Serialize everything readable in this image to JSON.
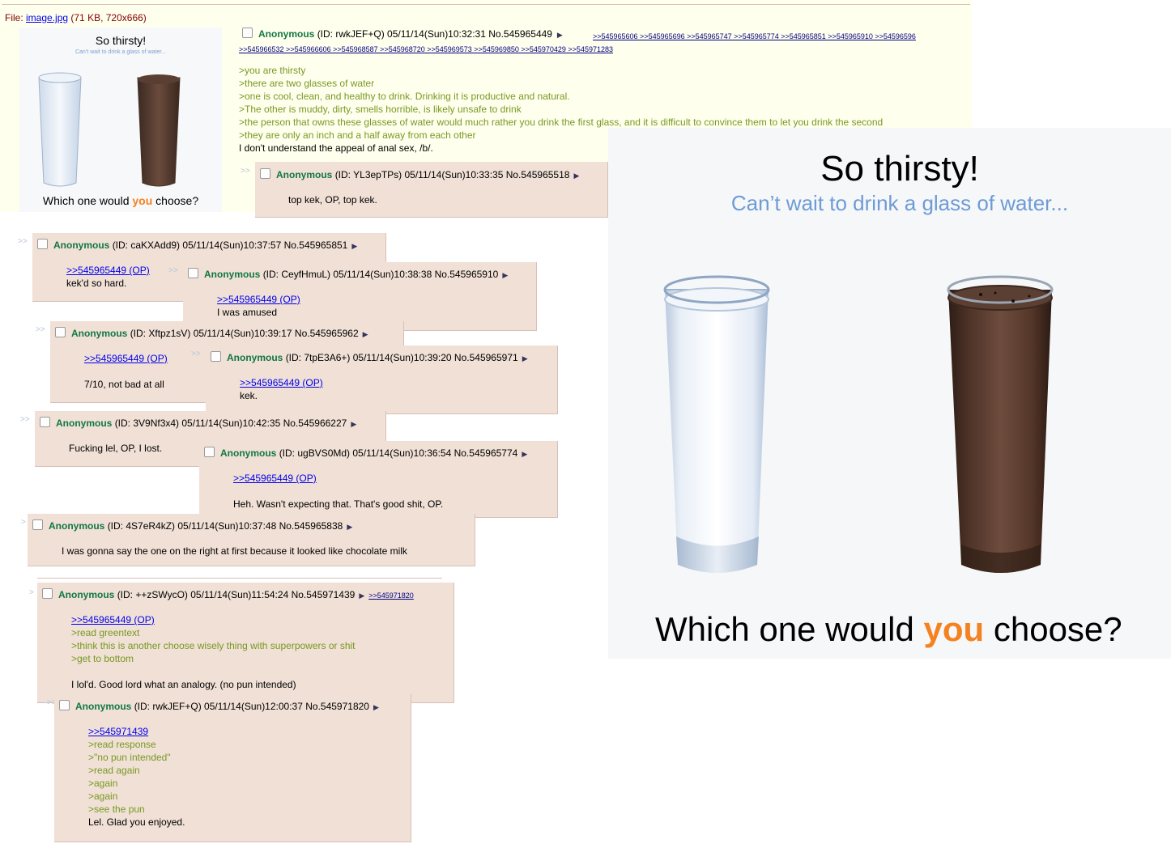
{
  "op": {
    "file_label": "File:",
    "file_name": "image.jpg",
    "file_meta": "(71 KB, 720x666)",
    "name": "Anonymous",
    "meta": "(ID: rwkJEF+Q) 05/11/14(Sun)10:32:31 No.545965449",
    "backlinks_row1": ">>545965606 >>545965696 >>545965747 >>545965774 >>545965851 >>545965910 >>54596596",
    "backlinks_row2": ">>545966532 >>545966606 >>545968587 >>545968720 >>545969573 >>545969850 >>545970429 >>545971283",
    "lines": [
      ">you are thirsty",
      ">there are two glasses of water",
      ">one is cool, clean, and healthy to drink. Drinking it is productive and natural.",
      ">The other is muddy, dirty, smells horrible, is likely unsafe to drink",
      ">the person that owns these glasses of water would much rather you drink the first glass, and it is difficult to convince them to let you drink the second",
      ">they are only an inch and a half away from each other",
      "I don't understand the appeal of anal sex, /b/."
    ]
  },
  "image": {
    "title": "So thirsty!",
    "subtitle": "Can’t wait to drink a glass of water...",
    "bottom_pre": "Which one would ",
    "bottom_you": "you",
    "bottom_post": " choose?"
  },
  "posts": [
    {
      "name": "Anonymous",
      "meta": "(ID: YL3epTPs) 05/11/14(Sun)10:33:35 No.545965518",
      "lines": [
        "top kek, OP, top kek."
      ]
    },
    {
      "name": "Anonymous",
      "meta": "(ID: caKXAdd9) 05/11/14(Sun)10:37:57 No.545965851",
      "link": ">>545965449 (OP)",
      "lines": [
        "kek'd so hard."
      ]
    },
    {
      "name": "Anonymous",
      "meta": "(ID: CeyfHmuL) 05/11/14(Sun)10:38:38 No.545965910",
      "link": ">>545965449 (OP)",
      "lines": [
        "I was amused"
      ]
    },
    {
      "name": "Anonymous",
      "meta": "(ID: Xftpz1sV) 05/11/14(Sun)10:39:17 No.545965962",
      "link": ">>545965449 (OP)",
      "lines": [
        "7/10, not bad at all"
      ]
    },
    {
      "name": "Anonymous",
      "meta": "(ID: 7tpE3A6+) 05/11/14(Sun)10:39:20 No.545965971",
      "link": ">>545965449 (OP)",
      "lines": [
        "kek."
      ]
    },
    {
      "name": "Anonymous",
      "meta": "(ID: 3V9Nf3x4) 05/11/14(Sun)10:42:35 No.545966227",
      "lines": [
        "Fucking lel, OP, I lost."
      ]
    },
    {
      "name": "Anonymous",
      "meta": "(ID: ugBVS0Md) 05/11/14(Sun)10:36:54 No.545965774",
      "link": ">>545965449 (OP)",
      "lines": [
        "Heh. Wasn't expecting that. That's good shit, OP."
      ]
    },
    {
      "name": "Anonymous",
      "meta": "(ID: 4S7eR4kZ) 05/11/14(Sun)10:37:48 No.545965838",
      "lines": [
        "I was gonna say the one on the right at first because it looked like chocolate milk"
      ]
    },
    {
      "name": "Anonymous",
      "meta": "(ID: ++zSWycO) 05/11/14(Sun)11:54:24 No.545971439",
      "backlink": ">>545971820",
      "link": ">>545965449 (OP)",
      "lines": [
        ">read greentext",
        ">think this is another choose wisely thing with superpowers or shit",
        ">get to bottom",
        "",
        "I lol'd. Good lord what an analogy. (no pun intended)"
      ]
    },
    {
      "name": "Anonymous",
      "meta": "(ID: rwkJEF+Q) 05/11/14(Sun)12:00:37 No.545971820",
      "link": ">>545971439",
      "lines": [
        ">read response",
        ">\"no pun intended\"",
        ">read again",
        ">again",
        ">again",
        ">see the pun",
        "Lel. Glad you enjoyed."
      ]
    }
  ]
}
